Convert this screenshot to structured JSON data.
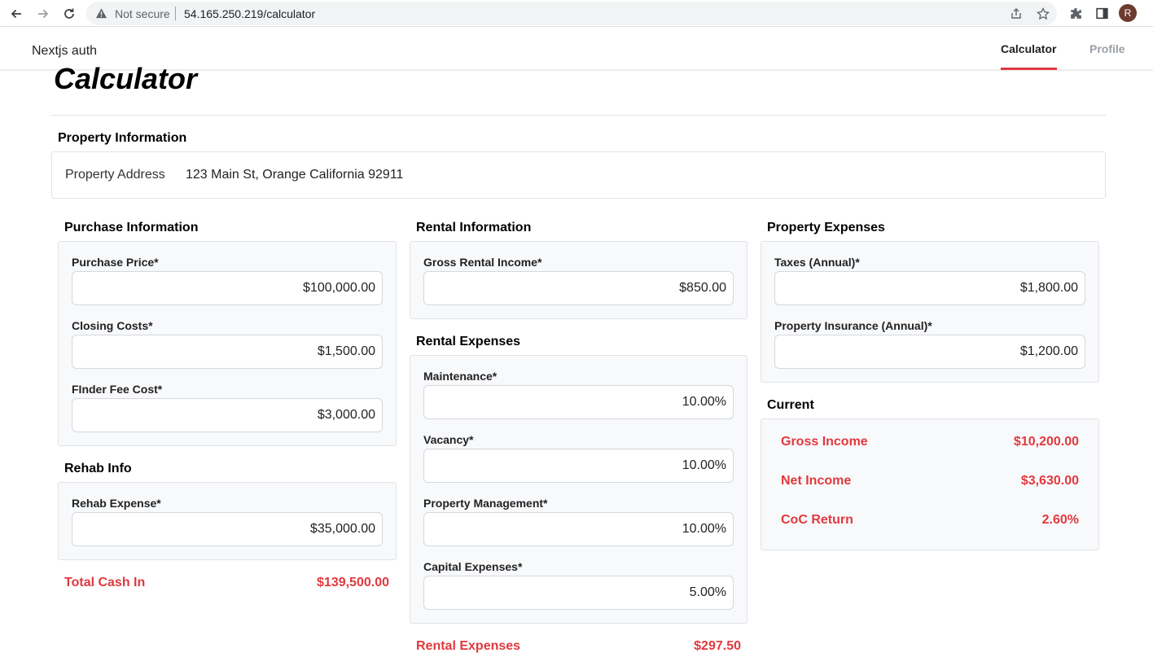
{
  "browser": {
    "security_label": "Not secure",
    "url": "54.165.250.219/calculator",
    "profile_initial": "R"
  },
  "header": {
    "brand": "Nextjs auth",
    "tabs": [
      {
        "label": "Calculator",
        "active": true
      },
      {
        "label": "Profile",
        "active": false
      }
    ]
  },
  "page": {
    "title": "Calculator"
  },
  "property_info": {
    "title": "Property Information",
    "address_label": "Property Address",
    "address_value": "123 Main St, Orange California 92911"
  },
  "purchase": {
    "title": "Purchase Information",
    "fields": [
      {
        "label": "Purchase Price*",
        "value": "$100,000.00"
      },
      {
        "label": "Closing Costs*",
        "value": "$1,500.00"
      },
      {
        "label": "FInder Fee Cost*",
        "value": "$3,000.00"
      }
    ]
  },
  "rehab": {
    "title": "Rehab Info",
    "fields": [
      {
        "label": "Rehab Expense*",
        "value": "$35,000.00"
      }
    ],
    "total_label": "Total Cash In",
    "total_value": "$139,500.00"
  },
  "rental_info": {
    "title": "Rental Information",
    "fields": [
      {
        "label": "Gross Rental Income*",
        "value": "$850.00"
      }
    ]
  },
  "rental_expenses": {
    "title": "Rental Expenses",
    "fields": [
      {
        "label": "Maintenance*",
        "value": "10.00%"
      },
      {
        "label": "Vacancy*",
        "value": "10.00%"
      },
      {
        "label": "Property Management*",
        "value": "10.00%"
      },
      {
        "label": "Capital Expenses*",
        "value": "5.00%"
      }
    ],
    "total_label": "Rental Expenses",
    "total_value": "$297.50"
  },
  "property_expenses": {
    "title": "Property Expenses",
    "fields": [
      {
        "label": "Taxes (Annual)*",
        "value": "$1,800.00"
      },
      {
        "label": "Property Insurance (Annual)*",
        "value": "$1,200.00"
      }
    ]
  },
  "current": {
    "title": "Current",
    "rows": [
      {
        "label": "Gross Income",
        "value": "$10,200.00"
      },
      {
        "label": "Net Income",
        "value": "$3,630.00"
      },
      {
        "label": "CoC Return",
        "value": "2.60%"
      }
    ]
  },
  "colors": {
    "accent": "#e0393e",
    "card_bg": "#f8f9fb"
  }
}
